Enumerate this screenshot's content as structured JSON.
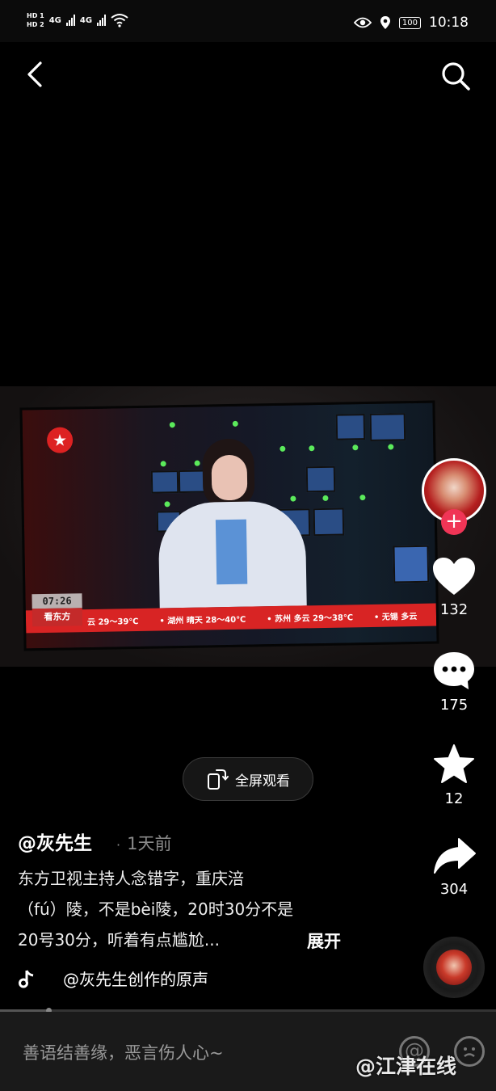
{
  "status_bar": {
    "sim1": "HD 1",
    "sim2": "HD 2",
    "net1": "4G",
    "net2": "4G",
    "battery": "100",
    "time": "10:18"
  },
  "video": {
    "tv_clock": "07:26",
    "tv_channel": "看东方",
    "ticker": [
      "云 29～39℃",
      "• 湖州 晴天 28～40℃",
      "• 苏州 多云 29～38℃",
      "• 无锡 多云"
    ]
  },
  "actions": {
    "likes": "132",
    "comments": "175",
    "favorites": "12",
    "shares": "304"
  },
  "fullscreen_label": "全屏观看",
  "post": {
    "author": "@灰先生",
    "time_ago": "1天前",
    "caption_lines": [
      "东方卫视主持人念错字，重庆涪",
      "（fú）陵，不是bèi陵，20时30分不是",
      "20号30分，听着有点尴尬..."
    ],
    "expand_label": "展开",
    "music": "@灰先生创作的原声"
  },
  "progress": 0.1,
  "comment_placeholder": "善语结善缘，恶言伤人心~",
  "watermark": "@江津在线",
  "colors": {
    "follow": "#f03556",
    "ticker": "#d82424"
  }
}
